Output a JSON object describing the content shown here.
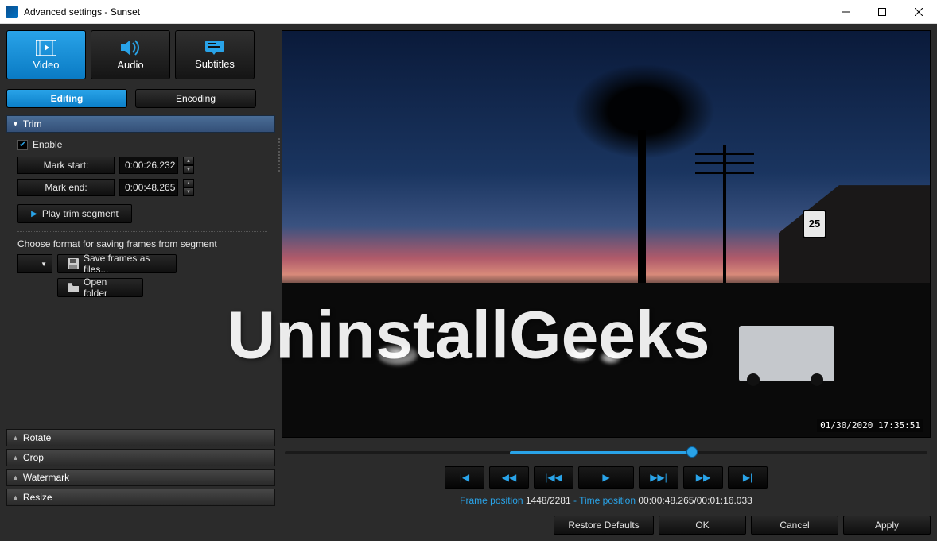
{
  "titlebar": {
    "title": "Advanced settings - Sunset"
  },
  "bigtabs": {
    "video": "Video",
    "audio": "Audio",
    "subtitles": "Subtitles"
  },
  "subtabs": {
    "editing": "Editing",
    "encoding": "Encoding"
  },
  "sections": {
    "trim": "Trim",
    "rotate": "Rotate",
    "crop": "Crop",
    "watermark": "Watermark",
    "resize": "Resize"
  },
  "trim": {
    "enable": "Enable",
    "mark_start": "Mark start:",
    "mark_end": "Mark end:",
    "start_value": "0:00:26.232",
    "end_value": "0:00:48.265",
    "play_segment": "Play trim segment",
    "choose_format": "Choose format for saving frames from segment",
    "save_files": "Save frames as files...",
    "open_folder": "Open folder"
  },
  "preview": {
    "timestamp": "01/30/2020  17:35:51",
    "sign": "25"
  },
  "watermark_text": "UninstallGeeks",
  "position": {
    "frame_label": "Frame position",
    "frame_value": "1448/2281",
    "sep": "-",
    "time_label": "Time position",
    "time_value": "00:00:48.265/00:01:16.033"
  },
  "buttons": {
    "restore": "Restore Defaults",
    "ok": "OK",
    "cancel": "Cancel",
    "apply": "Apply"
  }
}
